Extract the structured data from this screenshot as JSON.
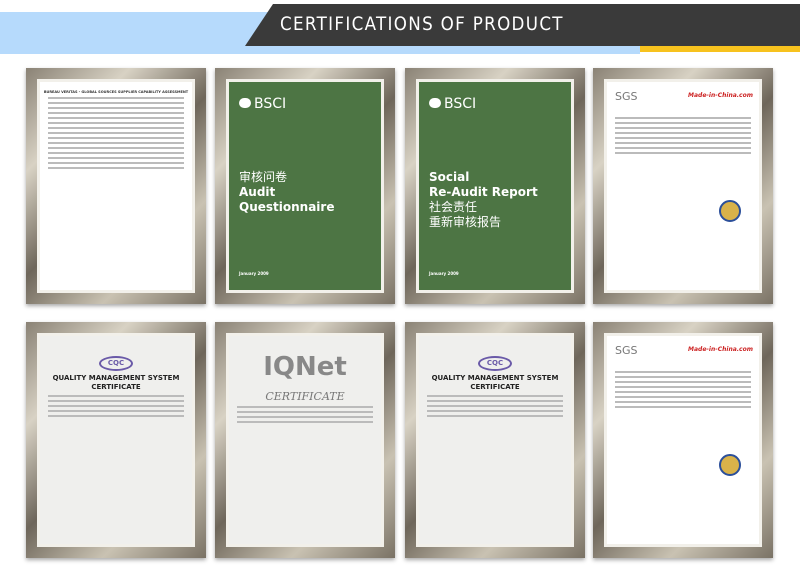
{
  "header": {
    "title": "CERTIFICATIONS OF PRODUCT",
    "colors": {
      "blue": "#b6dafc",
      "dark": "#3a3a3a",
      "yellow": "#f7c21e"
    }
  },
  "certs": {
    "bsci_sca": {
      "heading": "BUREAU VERITAS - GLOBAL SOURCES SUPPLIER CAPABILITY ASSESSMENT"
    },
    "audit": {
      "brand": "BSCI",
      "cn": "审核问卷",
      "en1": "Audit",
      "en2": "Questionnaire",
      "date": "January 2009"
    },
    "social": {
      "brand": "BSCI",
      "en1": "Social",
      "en2": "Re-Audit Report",
      "cn1": "社会责任",
      "cn2": "重新审核报告",
      "date": "January 2009"
    },
    "sgs1": {
      "brand": "SGS",
      "partner": "Made-in-China.com"
    },
    "cqc": {
      "logo": "CQC",
      "line1": "QUALITY MANAGEMENT SYSTEM",
      "line2": "CERTIFICATE"
    },
    "iqnet": {
      "logo": "IQNet",
      "title": "CERTIFICATE"
    },
    "cqc2": {
      "logo": "CQC",
      "line1": "QUALITY MANAGEMENT SYSTEM",
      "line2": "CERTIFICATE"
    },
    "sgs2": {
      "brand": "SGS",
      "partner": "Made-in-China.com"
    }
  }
}
